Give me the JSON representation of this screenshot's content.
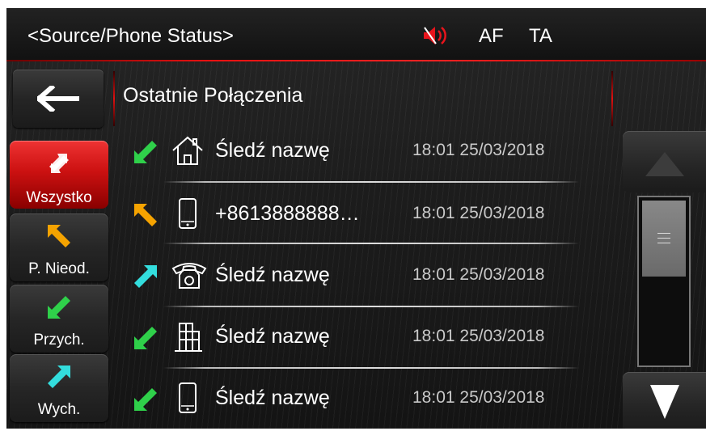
{
  "header": {
    "title": "<Source/Phone Status>",
    "af": "AF",
    "ta": "TA",
    "mute_icon": "speaker-muted-icon",
    "accent_color": "#e21b1b"
  },
  "list": {
    "title": "Ostatnie Połączenia",
    "rows": [
      {
        "type": "incoming",
        "device": "home",
        "name": "Śledź nazwę",
        "time": "18:01 25/03/2018"
      },
      {
        "type": "missed",
        "device": "mobile",
        "name": "+8613888888…",
        "time": "18:01 25/03/2018"
      },
      {
        "type": "outgoing",
        "device": "landline",
        "name": "Śledź nazwę",
        "time": "18:01 25/03/2018"
      },
      {
        "type": "incoming",
        "device": "office",
        "name": "Śledź nazwę",
        "time": "18:01 25/03/2018"
      },
      {
        "type": "incoming",
        "device": "mobile",
        "name": "Śledź nazwę",
        "time": "18:01 25/03/2018"
      }
    ]
  },
  "tabs": [
    {
      "label": "Wszystko",
      "icon": "all-calls-icon",
      "active": true
    },
    {
      "label": "P. Nieod.",
      "icon": "missed-call-icon",
      "active": false
    },
    {
      "label": "Przych.",
      "icon": "incoming-call-icon",
      "active": false
    },
    {
      "label": "Wych.",
      "icon": "outgoing-call-icon",
      "active": false
    }
  ],
  "colors": {
    "incoming": "#2fd04a",
    "missed": "#f5a300",
    "outgoing": "#33dddd",
    "active_tab": "#d01515"
  }
}
